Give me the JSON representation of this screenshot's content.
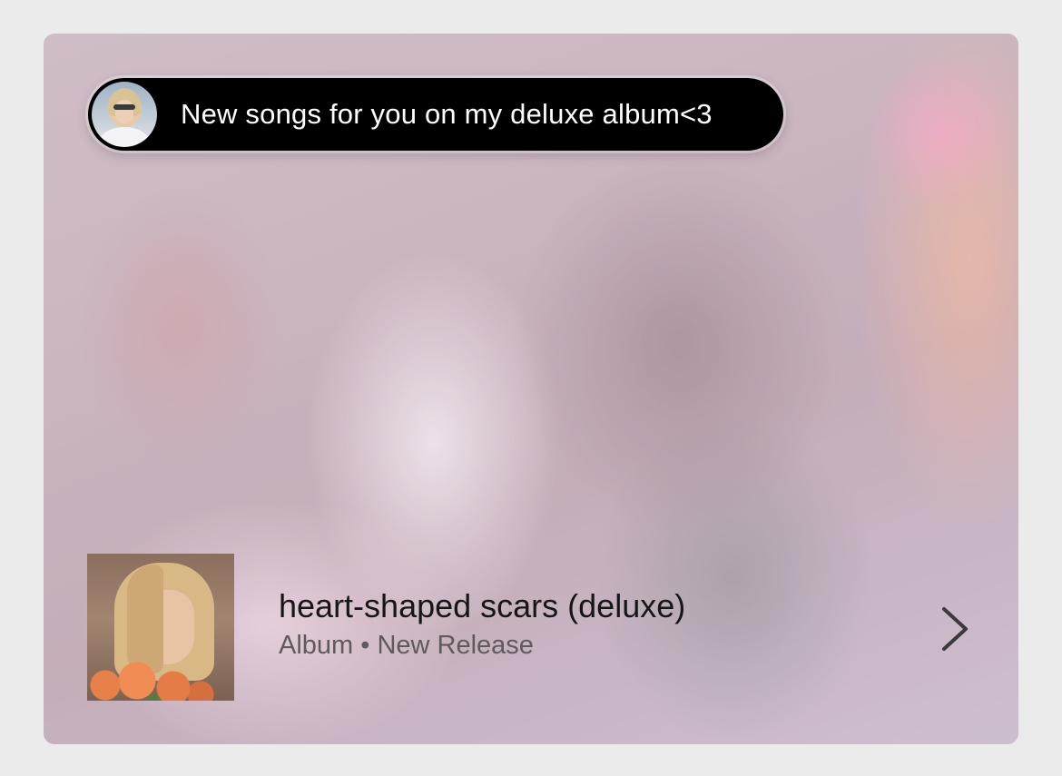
{
  "promo": {
    "message": "New songs for you on my deluxe album<3",
    "avatar_icon": "artist-avatar"
  },
  "release": {
    "title": "heart-shaped scars (deluxe)",
    "meta": "Album • New Release",
    "cover_icon": "album-cover-art"
  },
  "navigation": {
    "icon": "chevron-right-icon"
  },
  "colors": {
    "page_background": "#ebebeb",
    "pill_background": "#000000",
    "pill_text": "#ffffff",
    "title_text": "#161616",
    "meta_text": "#5e5a5e"
  }
}
